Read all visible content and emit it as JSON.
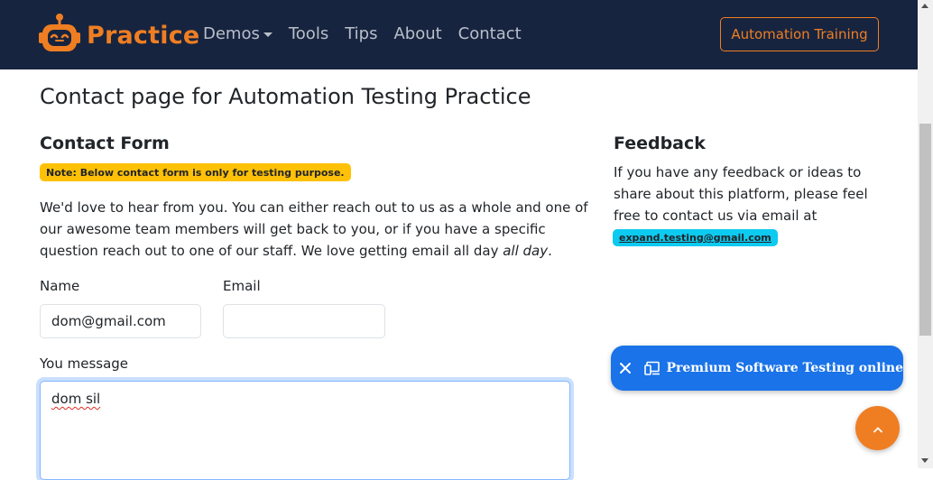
{
  "navbar": {
    "brand": "Practice",
    "links": [
      "Demos",
      "Tools",
      "Tips",
      "About",
      "Contact"
    ],
    "cta": "Automation Training",
    "colors": {
      "background": "#17243f",
      "accent": "#ef7e23",
      "link": "#b9bfca"
    }
  },
  "page": {
    "title": "Contact page for Automation Testing Practice"
  },
  "contact_form": {
    "heading": "Contact Form",
    "note": "Note: Below contact form is only for testing purpose.",
    "intro_main": "We'd love to hear from you. You can either reach out to us as a whole and one of our awesome team members will get back to you, or if you have a specific question reach out to one of our staff. We love getting email all day ",
    "intro_em": "all day",
    "intro_end": ".",
    "name_label": "Name",
    "name_value": "dom@gmail.com",
    "email_label": "Email",
    "email_value": "",
    "message_label": "You message",
    "message_value": "dom sil"
  },
  "feedback": {
    "heading": "Feedback",
    "text": "If you have any feedback or ideas to share about this platform, please feel free to contact us via email at",
    "email": "expand.testing@gmail.com"
  },
  "promo": {
    "text": "Premium Software Testing online",
    "icons": [
      "close-icon",
      "devices-icon"
    ],
    "color": "#1a73e8"
  },
  "back_to_top": {
    "icon": "chevron-up-icon"
  }
}
